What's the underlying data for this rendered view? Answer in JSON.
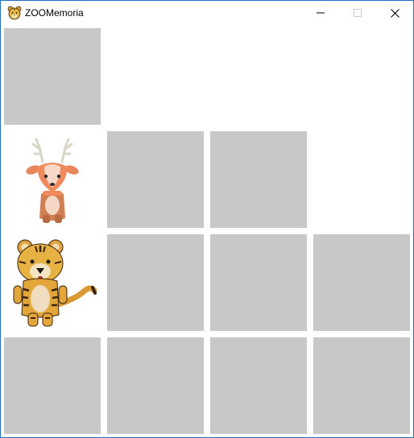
{
  "window": {
    "title": "ZOOMemoria",
    "app_icon": "tiger-face-icon",
    "controls": {
      "minimize_icon": "minimize-icon",
      "maximize_icon": "maximize-icon",
      "close_icon": "close-icon"
    }
  },
  "board": {
    "rows": 4,
    "columns": 4,
    "hidden_card_color": "#c8c8c8",
    "cards": [
      {
        "row": 1,
        "col": 1,
        "state": "hidden"
      },
      {
        "row": 1,
        "col": 2,
        "state": "empty"
      },
      {
        "row": 1,
        "col": 3,
        "state": "empty"
      },
      {
        "row": 1,
        "col": 4,
        "state": "empty"
      },
      {
        "row": 2,
        "col": 1,
        "state": "revealed",
        "animal": "deer"
      },
      {
        "row": 2,
        "col": 2,
        "state": "hidden"
      },
      {
        "row": 2,
        "col": 3,
        "state": "hidden"
      },
      {
        "row": 2,
        "col": 4,
        "state": "empty"
      },
      {
        "row": 3,
        "col": 1,
        "state": "revealed",
        "animal": "tiger"
      },
      {
        "row": 3,
        "col": 2,
        "state": "hidden"
      },
      {
        "row": 3,
        "col": 3,
        "state": "hidden"
      },
      {
        "row": 3,
        "col": 4,
        "state": "hidden"
      },
      {
        "row": 4,
        "col": 1,
        "state": "hidden"
      },
      {
        "row": 4,
        "col": 2,
        "state": "hidden"
      },
      {
        "row": 4,
        "col": 3,
        "state": "hidden"
      },
      {
        "row": 4,
        "col": 4,
        "state": "hidden"
      }
    ]
  }
}
